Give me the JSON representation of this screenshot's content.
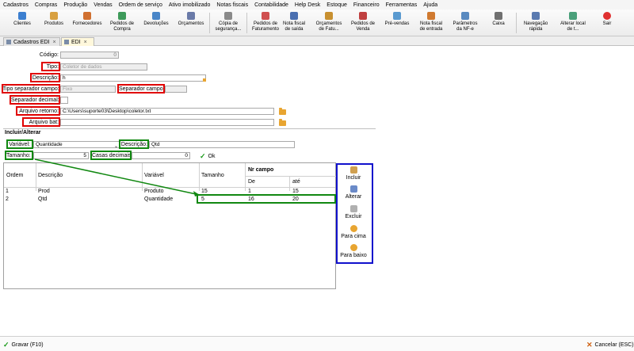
{
  "menu": [
    "Cadastros",
    "Compras",
    "Produção",
    "Vendas",
    "Ordem de serviço",
    "Ativo imobilizado",
    "Notas fiscais",
    "Contabilidade",
    "Help Desk",
    "Estoque",
    "Financeiro",
    "Ferramentas",
    "Ajuda"
  ],
  "toolbar": [
    {
      "l1": "Clientes",
      "l2": ""
    },
    {
      "l1": "Produtos",
      "l2": ""
    },
    {
      "l1": "Fornecedores",
      "l2": ""
    },
    {
      "l1": "Pedidos de",
      "l2": "Compra"
    },
    {
      "l1": "Devoluções",
      "l2": ""
    },
    {
      "l1": "Orçamentos",
      "l2": ""
    },
    {
      "l1": "Cópia de",
      "l2": "segurança..."
    },
    {
      "l1": "Pedidos de",
      "l2": "Faturamento"
    },
    {
      "l1": "Nota fiscal",
      "l2": "de saída"
    },
    {
      "l1": "Orçamentos",
      "l2": "de Fatu..."
    },
    {
      "l1": "Pedidos de",
      "l2": "Venda"
    },
    {
      "l1": "Pré-vendas",
      "l2": ""
    },
    {
      "l1": "Nota fiscal",
      "l2": "de entrada"
    },
    {
      "l1": "Parâmetros",
      "l2": "da NF-e"
    },
    {
      "l1": "Caixa",
      "l2": ""
    },
    {
      "l1": "Navegação",
      "l2": "rápida"
    },
    {
      "l1": "Alterar local",
      "l2": "de t..."
    },
    {
      "l1": "Sair",
      "l2": ""
    }
  ],
  "tabs": [
    {
      "label": "Cadastros EDI"
    },
    {
      "label": "EDI"
    }
  ],
  "tab_close": "×",
  "form": {
    "codigo_label": "Código:",
    "codigo_value": "0",
    "tipo_label": "Tipo:",
    "tipo_value": "Coletor de dados",
    "descricao_label": "Descrição:",
    "descricao_value": "h",
    "tipo_sep_label": "Tipo separador campo:",
    "tipo_sep_value": "Fixo",
    "sep_campo_label": "Separador campo:",
    "sep_dec_label": "Separador decimal:",
    "arq_ret_label": "Arquivo retorno:",
    "arq_ret_value": "C:\\Users\\suporte03\\Desktop\\coletor.txt",
    "arq_bat_label": "Arquivo bat:"
  },
  "group": {
    "title": "Incluir/Alterar",
    "variavel_label": "Variável:",
    "variavel_value": "Quantidade",
    "descricao_label": "Descrição:",
    "descricao_value": "Qtd",
    "tamanho_label": "Tamanho:",
    "tamanho_value": "5",
    "casas_label": "Casas decimais:",
    "casas_value": "0",
    "ok_label": "Ok"
  },
  "grid": {
    "headers": {
      "ordem": "Ordem",
      "descricao": "Descrição",
      "variavel": "Variável",
      "tamanho": "Tamanho",
      "nr_campo": "Nr campo",
      "de": "De",
      "ate": "até"
    },
    "rows": [
      {
        "ordem": "1",
        "descricao": "Prod",
        "variavel": "Produto",
        "tamanho": "15",
        "de": "1",
        "ate": "15"
      },
      {
        "ordem": "2",
        "descricao": "Qtd",
        "variavel": "Quantidade",
        "tamanho": "5",
        "de": "16",
        "ate": "20"
      }
    ]
  },
  "side_buttons": [
    "Incluir",
    "Alterar",
    "Excluir",
    "Para cima",
    "Para baixo"
  ],
  "footer": {
    "save": "Gravar (F10)",
    "cancel": "Cancelar (ESC)"
  }
}
